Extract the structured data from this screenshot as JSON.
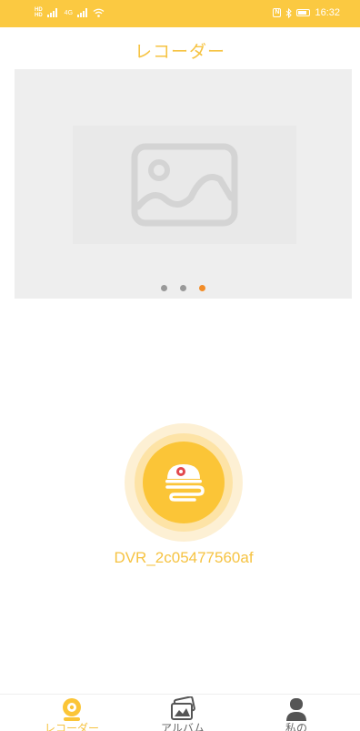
{
  "status_bar": {
    "hd_top": "HD",
    "hd_bottom": "HD",
    "network": "4G",
    "time": "16:32",
    "nfc": "N"
  },
  "header": {
    "title": "レコーダー"
  },
  "banner": {
    "slide_count": 3,
    "active_index": 2
  },
  "device": {
    "name": "DVR_2c05477560af"
  },
  "bottom_nav": {
    "items": [
      {
        "label": "レコーダー",
        "icon": "recorder-icon",
        "active": true
      },
      {
        "label": "アルバム",
        "icon": "album-icon",
        "active": false
      },
      {
        "label": "私の",
        "icon": "profile-icon",
        "active": false
      }
    ]
  },
  "colors": {
    "accent": "#fbc941",
    "title_text": "#f6c342",
    "active_dot": "#f28c28",
    "inactive_dot": "#999999"
  }
}
